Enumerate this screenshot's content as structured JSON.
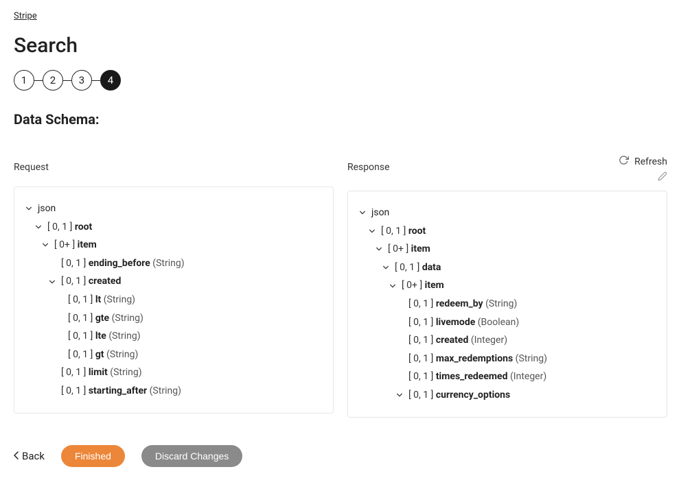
{
  "breadcrumb": "Stripe",
  "page_title": "Search",
  "steps": [
    "1",
    "2",
    "3",
    "4"
  ],
  "active_step_index": 3,
  "section_title": "Data Schema:",
  "request": {
    "label": "Request",
    "tree": [
      {
        "depth": 0,
        "expandable": true,
        "card": "",
        "name": "json",
        "nameBold": false,
        "type": ""
      },
      {
        "depth": 1,
        "expandable": true,
        "card": "[ 0, 1 ]",
        "name": "root",
        "nameBold": true,
        "type": ""
      },
      {
        "depth": 2,
        "expandable": true,
        "card": "[ 0+ ]",
        "name": "item",
        "nameBold": true,
        "type": ""
      },
      {
        "depth": 3,
        "expandable": false,
        "card": "[ 0, 1 ]",
        "name": "ending_before",
        "nameBold": true,
        "type": "(String)"
      },
      {
        "depth": 3,
        "expandable": true,
        "card": "[ 0, 1 ]",
        "name": "created",
        "nameBold": true,
        "type": ""
      },
      {
        "depth": 4,
        "expandable": false,
        "card": "[ 0, 1 ]",
        "name": "lt",
        "nameBold": true,
        "type": "(String)"
      },
      {
        "depth": 4,
        "expandable": false,
        "card": "[ 0, 1 ]",
        "name": "gte",
        "nameBold": true,
        "type": "(String)"
      },
      {
        "depth": 4,
        "expandable": false,
        "card": "[ 0, 1 ]",
        "name": "lte",
        "nameBold": true,
        "type": "(String)"
      },
      {
        "depth": 4,
        "expandable": false,
        "card": "[ 0, 1 ]",
        "name": "gt",
        "nameBold": true,
        "type": "(String)"
      },
      {
        "depth": 3,
        "expandable": false,
        "card": "[ 0, 1 ]",
        "name": "limit",
        "nameBold": true,
        "type": "(String)"
      },
      {
        "depth": 3,
        "expandable": false,
        "card": "[ 0, 1 ]",
        "name": "starting_after",
        "nameBold": true,
        "type": "(String)"
      }
    ]
  },
  "response": {
    "label": "Response",
    "refresh_label": "Refresh",
    "tree": [
      {
        "depth": 0,
        "expandable": true,
        "card": "",
        "name": "json",
        "nameBold": false,
        "type": ""
      },
      {
        "depth": 1,
        "expandable": true,
        "card": "[ 0, 1 ]",
        "name": "root",
        "nameBold": true,
        "type": ""
      },
      {
        "depth": 2,
        "expandable": true,
        "card": "[ 0+ ]",
        "name": "item",
        "nameBold": true,
        "type": ""
      },
      {
        "depth": 3,
        "expandable": true,
        "card": "[ 0, 1 ]",
        "name": "data",
        "nameBold": true,
        "type": ""
      },
      {
        "depth": 4,
        "expandable": true,
        "card": "[ 0+ ]",
        "name": "item",
        "nameBold": true,
        "type": ""
      },
      {
        "depth": 5,
        "expandable": false,
        "card": "[ 0, 1 ]",
        "name": "redeem_by",
        "nameBold": true,
        "type": "(String)"
      },
      {
        "depth": 5,
        "expandable": false,
        "card": "[ 0, 1 ]",
        "name": "livemode",
        "nameBold": true,
        "type": "(Boolean)"
      },
      {
        "depth": 5,
        "expandable": false,
        "card": "[ 0, 1 ]",
        "name": "created",
        "nameBold": true,
        "type": "(Integer)"
      },
      {
        "depth": 5,
        "expandable": false,
        "card": "[ 0, 1 ]",
        "name": "max_redemptions",
        "nameBold": true,
        "type": "(String)"
      },
      {
        "depth": 5,
        "expandable": false,
        "card": "[ 0, 1 ]",
        "name": "times_redeemed",
        "nameBold": true,
        "type": "(Integer)"
      },
      {
        "depth": 5,
        "expandable": true,
        "card": "[ 0, 1 ]",
        "name": "currency_options",
        "nameBold": true,
        "type": ""
      }
    ]
  },
  "footer": {
    "back": "Back",
    "finished": "Finished",
    "discard": "Discard Changes"
  }
}
